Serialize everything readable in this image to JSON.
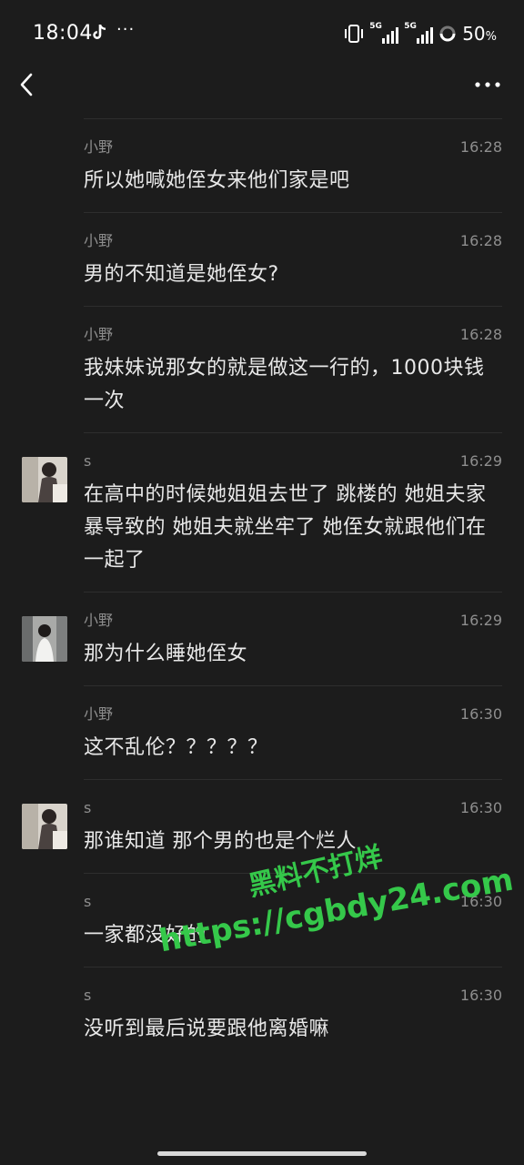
{
  "status_bar": {
    "time": "18:04",
    "dots": "···",
    "signal1_label": "5G",
    "signal2_label": "5G",
    "battery": "50",
    "battery_unit": "%"
  },
  "header": {
    "back_icon": "chevron-left-icon",
    "more_icon": "more-horizontal-icon"
  },
  "messages": [
    {
      "name": "小野",
      "time": "16:28",
      "text": "所以她喊她侄女来他们家是吧"
    },
    {
      "name": "小野",
      "time": "16:28",
      "text": "男的不知道是她侄女?"
    },
    {
      "name": "小野",
      "time": "16:28",
      "text": "我妹妹说那女的就是做这一行的，1000块钱一次"
    },
    {
      "name": "s",
      "time": "16:29",
      "text": "在高中的时候她姐姐去世了 跳楼的 她姐夫家暴导致的 她姐夫就坐牢了 她侄女就跟他们在一起了"
    },
    {
      "name": "小野",
      "time": "16:29",
      "text": "那为什么睡她侄女"
    },
    {
      "name": "小野",
      "time": "16:30",
      "text": "这不乱伦？？？？？"
    },
    {
      "name": "s",
      "time": "16:30",
      "text": "那谁知道 那个男的也是个烂人"
    },
    {
      "name": "s",
      "time": "16:30",
      "text": "一家都没好的"
    },
    {
      "name": "s",
      "time": "16:30",
      "text": "没听到最后说要跟他离婚嘛"
    }
  ],
  "watermark": {
    "line1": "黑料不打烊",
    "line2": "https://cgbdy24.com"
  }
}
